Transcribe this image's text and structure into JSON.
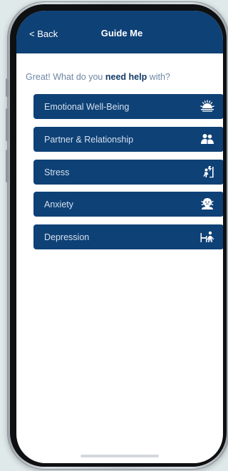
{
  "header": {
    "back_label": "< Back",
    "title": "Guide Me"
  },
  "prompt": {
    "prefix": "Great! What do you ",
    "emphasis": "need help",
    "suffix": " with?"
  },
  "options": [
    {
      "label": "Emotional Well-Being",
      "icon": "sunrise-icon"
    },
    {
      "label": "Partner & Relationship",
      "icon": "couple-icon"
    },
    {
      "label": "Stress",
      "icon": "stressed-person-icon"
    },
    {
      "label": "Anxiety",
      "icon": "anxious-head-icon"
    },
    {
      "label": "Depression",
      "icon": "person-in-bed-icon"
    }
  ],
  "colors": {
    "brand_navy": "#0e4176",
    "prompt_text": "#6f86a6",
    "background": "#dfe9ea"
  }
}
